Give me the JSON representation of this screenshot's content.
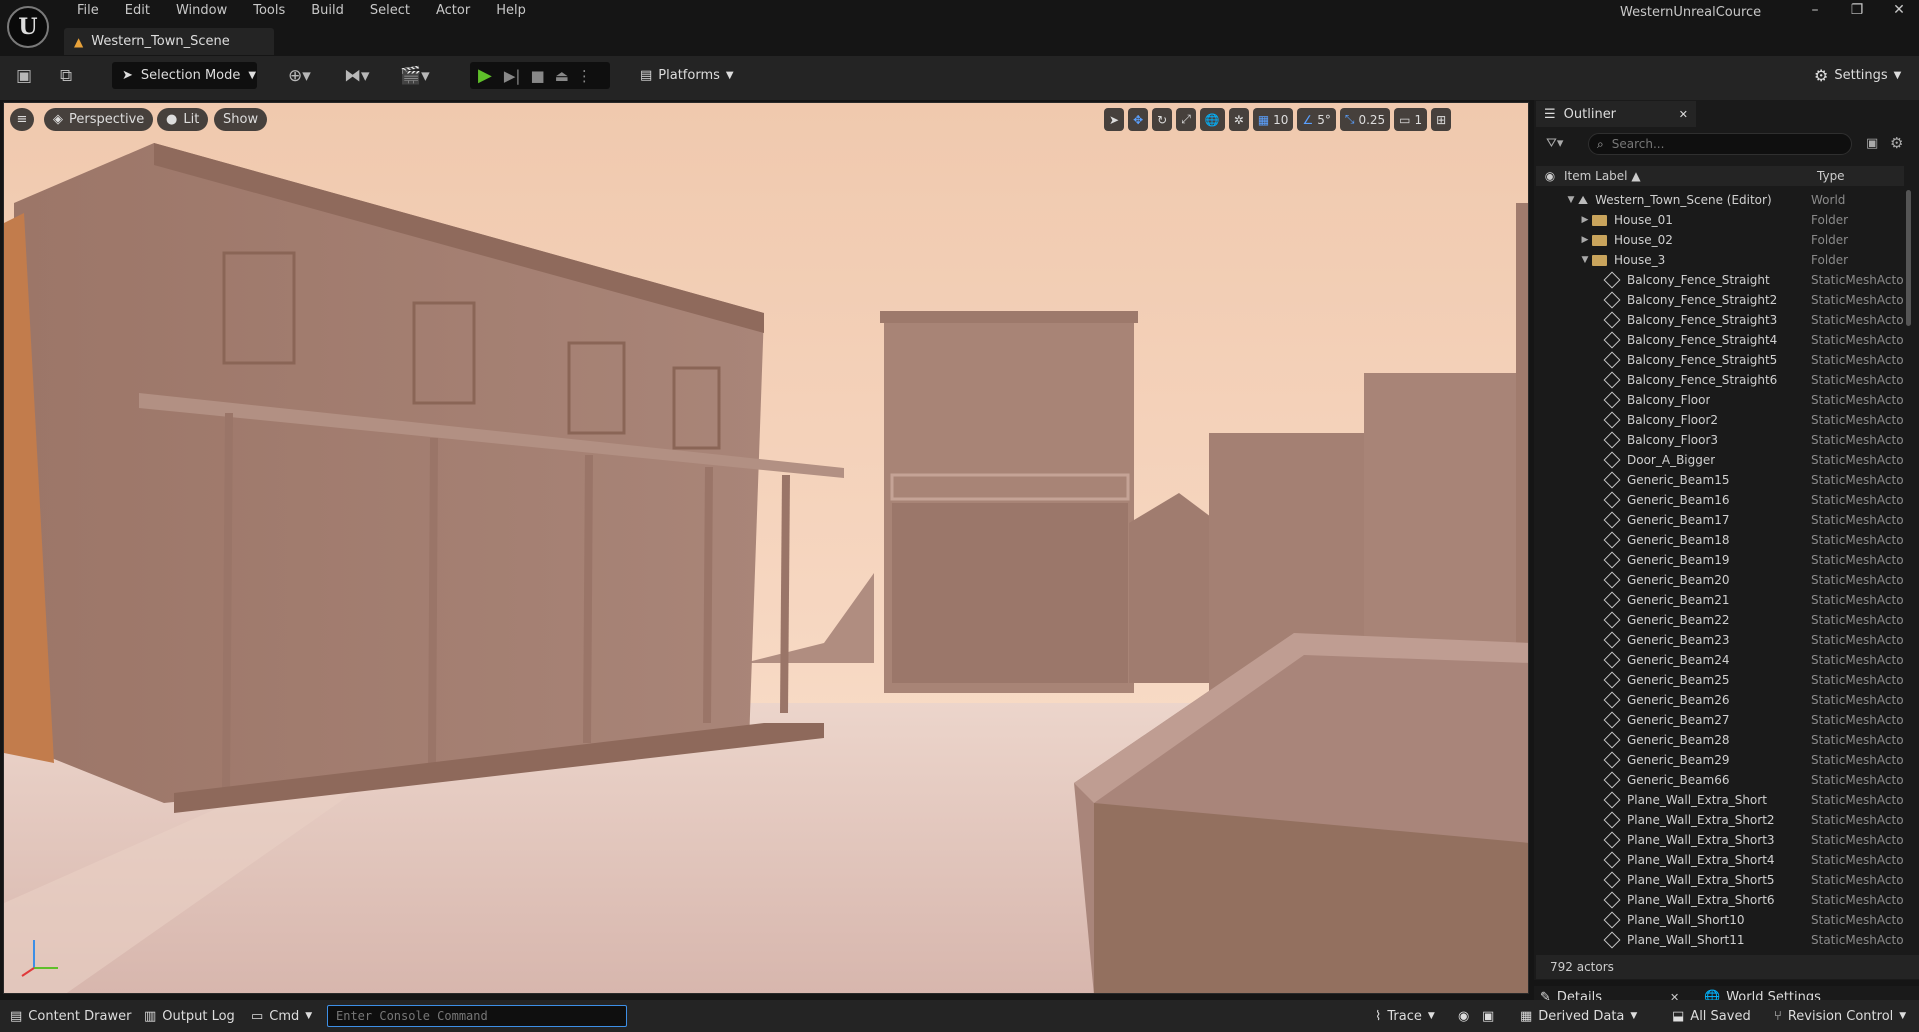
{
  "menu": [
    "File",
    "Edit",
    "Window",
    "Tools",
    "Build",
    "Select",
    "Actor",
    "Help"
  ],
  "document_tab": "Western_Town_Scene",
  "project_name": "WesternUnrealCource",
  "toolbar": {
    "selection_mode": "Selection Mode",
    "platforms": "Platforms",
    "settings": "Settings"
  },
  "viewport": {
    "perspective": "Perspective",
    "lit": "Lit",
    "show": "Show",
    "grid_snap": "10",
    "rotation_snap": "5°",
    "scale_snap": "0.25",
    "camera_speed": "1"
  },
  "outliner": {
    "tab": "Outliner",
    "search_placeholder": "Search...",
    "col_label": "Item Label ▲",
    "col_type": "Type",
    "rows": [
      {
        "label": "Western_Town_Scene (Editor)",
        "type": "World",
        "indent": 0,
        "kind": "world",
        "expanded": true
      },
      {
        "label": "House_01",
        "type": "Folder",
        "indent": 1,
        "kind": "folder",
        "expanded": false
      },
      {
        "label": "House_02",
        "type": "Folder",
        "indent": 1,
        "kind": "folder",
        "expanded": false
      },
      {
        "label": "House_3",
        "type": "Folder",
        "indent": 1,
        "kind": "folder",
        "expanded": true
      },
      {
        "label": "Balcony_Fence_Straight",
        "type": "StaticMeshActor",
        "indent": 2,
        "kind": "mesh"
      },
      {
        "label": "Balcony_Fence_Straight2",
        "type": "StaticMeshActor",
        "indent": 2,
        "kind": "mesh"
      },
      {
        "label": "Balcony_Fence_Straight3",
        "type": "StaticMeshActor",
        "indent": 2,
        "kind": "mesh"
      },
      {
        "label": "Balcony_Fence_Straight4",
        "type": "StaticMeshActor",
        "indent": 2,
        "kind": "mesh"
      },
      {
        "label": "Balcony_Fence_Straight5",
        "type": "StaticMeshActor",
        "indent": 2,
        "kind": "mesh"
      },
      {
        "label": "Balcony_Fence_Straight6",
        "type": "StaticMeshActor",
        "indent": 2,
        "kind": "mesh"
      },
      {
        "label": "Balcony_Floor",
        "type": "StaticMeshActor",
        "indent": 2,
        "kind": "mesh"
      },
      {
        "label": "Balcony_Floor2",
        "type": "StaticMeshActor",
        "indent": 2,
        "kind": "mesh"
      },
      {
        "label": "Balcony_Floor3",
        "type": "StaticMeshActor",
        "indent": 2,
        "kind": "mesh"
      },
      {
        "label": "Door_A_Bigger",
        "type": "StaticMeshActor",
        "indent": 2,
        "kind": "mesh"
      },
      {
        "label": "Generic_Beam15",
        "type": "StaticMeshActor",
        "indent": 2,
        "kind": "mesh"
      },
      {
        "label": "Generic_Beam16",
        "type": "StaticMeshActor",
        "indent": 2,
        "kind": "mesh"
      },
      {
        "label": "Generic_Beam17",
        "type": "StaticMeshActor",
        "indent": 2,
        "kind": "mesh"
      },
      {
        "label": "Generic_Beam18",
        "type": "StaticMeshActor",
        "indent": 2,
        "kind": "mesh"
      },
      {
        "label": "Generic_Beam19",
        "type": "StaticMeshActor",
        "indent": 2,
        "kind": "mesh"
      },
      {
        "label": "Generic_Beam20",
        "type": "StaticMeshActor",
        "indent": 2,
        "kind": "mesh"
      },
      {
        "label": "Generic_Beam21",
        "type": "StaticMeshActor",
        "indent": 2,
        "kind": "mesh"
      },
      {
        "label": "Generic_Beam22",
        "type": "StaticMeshActor",
        "indent": 2,
        "kind": "mesh"
      },
      {
        "label": "Generic_Beam23",
        "type": "StaticMeshActor",
        "indent": 2,
        "kind": "mesh"
      },
      {
        "label": "Generic_Beam24",
        "type": "StaticMeshActor",
        "indent": 2,
        "kind": "mesh"
      },
      {
        "label": "Generic_Beam25",
        "type": "StaticMeshActor",
        "indent": 2,
        "kind": "mesh"
      },
      {
        "label": "Generic_Beam26",
        "type": "StaticMeshActor",
        "indent": 2,
        "kind": "mesh"
      },
      {
        "label": "Generic_Beam27",
        "type": "StaticMeshActor",
        "indent": 2,
        "kind": "mesh"
      },
      {
        "label": "Generic_Beam28",
        "type": "StaticMeshActor",
        "indent": 2,
        "kind": "mesh"
      },
      {
        "label": "Generic_Beam29",
        "type": "StaticMeshActor",
        "indent": 2,
        "kind": "mesh"
      },
      {
        "label": "Generic_Beam66",
        "type": "StaticMeshActor",
        "indent": 2,
        "kind": "mesh"
      },
      {
        "label": "Plane_Wall_Extra_Short",
        "type": "StaticMeshActor",
        "indent": 2,
        "kind": "mesh"
      },
      {
        "label": "Plane_Wall_Extra_Short2",
        "type": "StaticMeshActor",
        "indent": 2,
        "kind": "mesh"
      },
      {
        "label": "Plane_Wall_Extra_Short3",
        "type": "StaticMeshActor",
        "indent": 2,
        "kind": "mesh"
      },
      {
        "label": "Plane_Wall_Extra_Short4",
        "type": "StaticMeshActor",
        "indent": 2,
        "kind": "mesh"
      },
      {
        "label": "Plane_Wall_Extra_Short5",
        "type": "StaticMeshActor",
        "indent": 2,
        "kind": "mesh"
      },
      {
        "label": "Plane_Wall_Extra_Short6",
        "type": "StaticMeshActor",
        "indent": 2,
        "kind": "mesh"
      },
      {
        "label": "Plane_Wall_Short10",
        "type": "StaticMeshActor",
        "indent": 2,
        "kind": "mesh"
      },
      {
        "label": "Plane_Wall_Short11",
        "type": "StaticMeshActor",
        "indent": 2,
        "kind": "mesh"
      }
    ],
    "actor_count": "792 actors"
  },
  "details_tabs": {
    "details": "Details",
    "world_settings": "World Settings"
  },
  "statusbar": {
    "content_drawer": "Content Drawer",
    "output_log": "Output Log",
    "cmd": "Cmd",
    "console_placeholder": "Enter Console Command",
    "trace": "Trace",
    "derived_data": "Derived Data",
    "all_saved": "All Saved",
    "revision_control": "Revision Control"
  },
  "colors": {
    "accent": "#3d8fe6",
    "play": "#5fbf2a",
    "folder": "#c9a45c"
  }
}
